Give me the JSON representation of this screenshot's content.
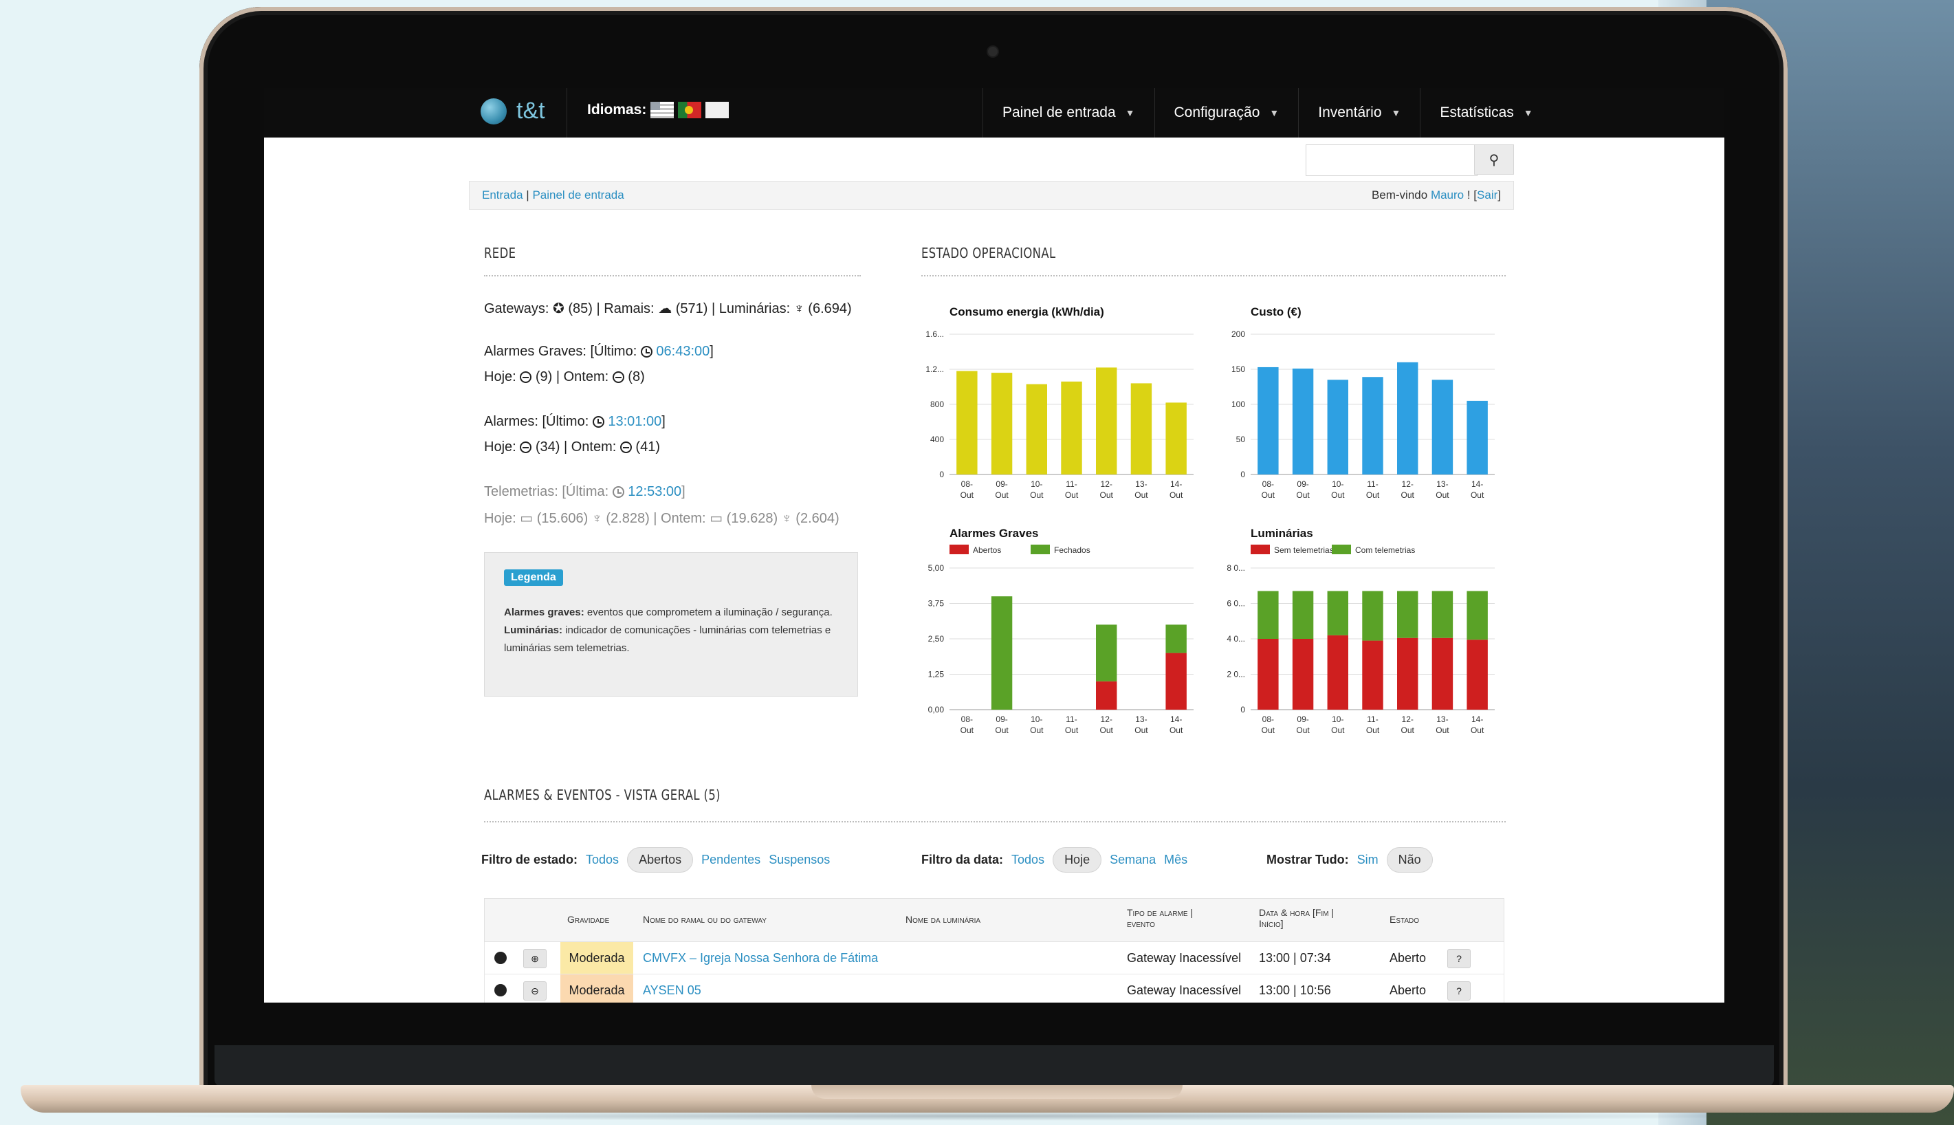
{
  "nav": {
    "brand": "t&t",
    "languages_label": "Idiomas:",
    "menu": [
      {
        "label": "Painel de entrada"
      },
      {
        "label": "Configuração"
      },
      {
        "label": "Inventário"
      },
      {
        "label": "Estatísticas"
      }
    ]
  },
  "search": {
    "placeholder": "",
    "button_icon": "search-icon"
  },
  "breadcrumb": {
    "home": "Entrada",
    "sep": "|",
    "current": "Painel de entrada",
    "welcome_prefix": "Bem-vindo",
    "user": "Mauro",
    "welcome_suffix": "! [",
    "logout": "Sair",
    "close": "]"
  },
  "rede": {
    "title": "Rede",
    "gateways_label": "Gateways:",
    "gateways_count": "(85)",
    "ramais_label": "| Ramais:",
    "ramais_count": "(571)",
    "luminarias_label": "| Luminárias:",
    "luminarias_count": "(6.694)",
    "graves_label": "Alarmes Graves: [Último:",
    "graves_time": "06:43:00",
    "graves_today": "Hoje:",
    "graves_today_count": "(9) | Ontem:",
    "graves_yesterday_count": "(8)",
    "alarmes_label": "Alarmes: [Último:",
    "alarmes_time": "13:01:00",
    "alarmes_today": "Hoje:",
    "alarmes_today_count": "(34) | Ontem:",
    "alarmes_yesterday_count": "(41)",
    "telemetrias_label": "Telemetrias: [Última:",
    "telemetrias_time": "12:53:00",
    "tel_today": "Hoje:",
    "tel_today_a": "(15.606)",
    "tel_today_b": "(2.828) | Ontem:",
    "tel_yest_a": "(19.628)",
    "tel_yest_b": "(2.604)",
    "close_bracket": "]"
  },
  "legenda": {
    "tag": "Legenda",
    "line1_bold": "Alarmes graves:",
    "line1": "eventos que comprometem a iluminação / segurança.",
    "line2_bold": "Luminárias:",
    "line2": "indicador de comunicações - luminárias com telemetrias e luminárias sem telemetrias."
  },
  "estado": {
    "title": "Estado operacional"
  },
  "chart_data": [
    {
      "type": "bar",
      "title": "Consumo energia (kWh/dia)",
      "categories": [
        "08-Out",
        "09-Out",
        "10-Out",
        "11-Out",
        "12-Out",
        "13-Out",
        "14-Out"
      ],
      "values": [
        1180,
        1160,
        1030,
        1060,
        1220,
        1040,
        820
      ],
      "yticks": [
        "0",
        "400",
        "800",
        "1.2...",
        "1.6..."
      ],
      "ylim": [
        0,
        1600
      ],
      "color": "#dbd314"
    },
    {
      "type": "bar",
      "title": "Custo (€)",
      "categories": [
        "08-Out",
        "09-Out",
        "10-Out",
        "11-Out",
        "12-Out",
        "13-Out",
        "14-Out"
      ],
      "values": [
        153,
        151,
        135,
        139,
        160,
        135,
        105
      ],
      "yticks": [
        "0",
        "50",
        "100",
        "150",
        "200"
      ],
      "ylim": [
        0,
        200
      ],
      "color": "#2ea0e2"
    },
    {
      "type": "bar",
      "title": "Alarmes Graves",
      "categories": [
        "08-Out",
        "09-Out",
        "10-Out",
        "11-Out",
        "12-Out",
        "13-Out",
        "14-Out"
      ],
      "series": [
        {
          "name": "Abertos",
          "color": "#cf1f1f",
          "values": [
            0,
            0,
            0,
            0,
            1,
            0,
            2
          ]
        },
        {
          "name": "Fechados",
          "color": "#5aa227",
          "values": [
            0,
            4,
            0,
            0,
            2,
            0,
            1
          ]
        }
      ],
      "yticks": [
        "0,00",
        "1,25",
        "2,50",
        "3,75",
        "5,00"
      ],
      "ylim": [
        0,
        5
      ],
      "stacked": true
    },
    {
      "type": "bar",
      "title": "Luminárias",
      "categories": [
        "08-Out",
        "09-Out",
        "10-Out",
        "11-Out",
        "12-Out",
        "13-Out",
        "14-Out"
      ],
      "series": [
        {
          "name": "Sem telemetrias",
          "color": "#cf1f1f",
          "values": [
            4000,
            4000,
            4200,
            3900,
            4050,
            4050,
            3950
          ]
        },
        {
          "name": "Com telemetrias",
          "color": "#5aa227",
          "values": [
            2700,
            2700,
            2500,
            2800,
            2650,
            2650,
            2750
          ]
        }
      ],
      "yticks": [
        "0",
        "2 0...",
        "4 0...",
        "6 0...",
        "8 0..."
      ],
      "ylim": [
        0,
        8000
      ],
      "stacked": true
    }
  ],
  "alarmes": {
    "title": "Alarmes & Eventos - Vista geral (5)"
  },
  "filters": {
    "estado_label": "Filtro de estado:",
    "estado_options": [
      "Todos",
      "Abertos",
      "Pendentes",
      "Suspensos"
    ],
    "data_label": "Filtro da data:",
    "data_options": [
      "Todos",
      "Hoje",
      "Semana",
      "Mês"
    ],
    "mostrar_label": "Mostrar Tudo:",
    "mostrar_options": [
      "Sim",
      "Não"
    ]
  },
  "table": {
    "headers": {
      "gravidade": "Gravidade",
      "nome_ramal": "Nome do ramal ou do gateway",
      "nome_luminaria": "Nome da luminária",
      "tipo_1": "Tipo de alarme |",
      "tipo_2": "evento",
      "data_1": "Data & hora [Fim |",
      "data_2": "Início]",
      "estado": "Estado"
    },
    "rows": [
      {
        "gravidade": "Moderada",
        "nome": "CMVFX – Igreja Nossa Senhora de Fátima",
        "tipo": "Gateway Inacessível",
        "data": "13:00 | 07:34",
        "estado": "Aberto",
        "action": "?"
      },
      {
        "gravidade": "Moderada",
        "nome": "AYSEN 05",
        "tipo": "Gateway Inacessível",
        "data": "13:00 | 10:56",
        "estado": "Aberto",
        "action": "?"
      }
    ]
  }
}
